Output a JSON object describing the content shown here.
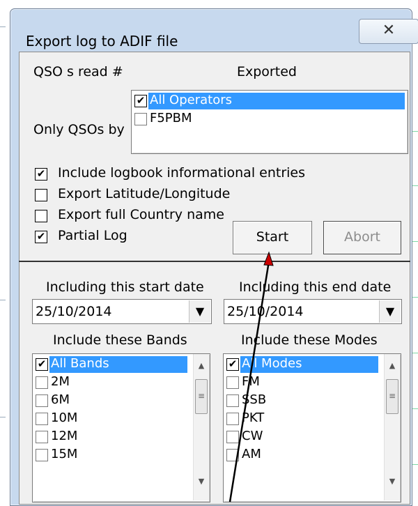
{
  "dialog": {
    "title": "Export log to ADIF file",
    "close_icon": "close-icon"
  },
  "top": {
    "qso_read_label": "QSO s read #",
    "exported_label": "Exported",
    "only_qsos_by_label": "Only QSOs by",
    "operators": [
      {
        "label": "All Operators",
        "checked": true,
        "selected": true
      },
      {
        "label": "F5PBM",
        "checked": false,
        "selected": false
      }
    ]
  },
  "options": [
    {
      "label": "Include logbook informational entries",
      "checked": true
    },
    {
      "label": "Export Latitude/Longitude",
      "checked": false
    },
    {
      "label": "Export full Country name",
      "checked": false
    },
    {
      "label": "Partial Log",
      "checked": true
    }
  ],
  "buttons": {
    "start": "Start",
    "abort": "Abort"
  },
  "dates": {
    "start_label": "Including this start date",
    "start_value": "25/10/2014",
    "end_label": "Including this end date",
    "end_value": "25/10/2014"
  },
  "bands": {
    "label": "Include these Bands",
    "items": [
      {
        "label": "All Bands",
        "checked": true,
        "selected": true
      },
      {
        "label": "2M",
        "checked": false,
        "selected": false
      },
      {
        "label": "6M",
        "checked": false,
        "selected": false
      },
      {
        "label": "10M",
        "checked": false,
        "selected": false
      },
      {
        "label": "12M",
        "checked": false,
        "selected": false
      },
      {
        "label": "15M",
        "checked": false,
        "selected": false
      }
    ]
  },
  "modes": {
    "label": "Include these Modes",
    "items": [
      {
        "label": "All Modes",
        "checked": true,
        "selected": true
      },
      {
        "label": "FM",
        "checked": false,
        "selected": false
      },
      {
        "label": "SSB",
        "checked": false,
        "selected": false
      },
      {
        "label": "PKT",
        "checked": false,
        "selected": false
      },
      {
        "label": "CW",
        "checked": false,
        "selected": false
      },
      {
        "label": "AM",
        "checked": false,
        "selected": false
      }
    ]
  },
  "colors": {
    "selection": "#3399ff",
    "annotation_arrow": "#cc0000",
    "frame": "#c7d9ee"
  }
}
